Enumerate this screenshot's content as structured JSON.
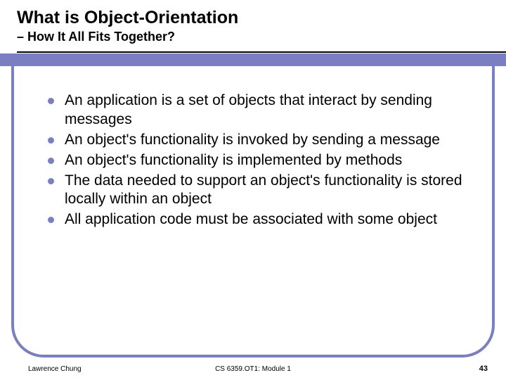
{
  "header": {
    "title": "What is Object-Orientation",
    "subtitle": "– How It All Fits Together?"
  },
  "bullets": [
    "An application is a set of objects that interact by sending messages",
    "An object's functionality is invoked by sending a message",
    "An object's functionality is implemented by methods",
    "The data needed to support an object's functionality is stored locally within an object",
    "All application code must be associated with some object"
  ],
  "footer": {
    "left": "Lawrence Chung",
    "center": "CS 6359.OT1: Module 1",
    "right": "43"
  },
  "colors": {
    "accent": "#7a7fc2"
  }
}
